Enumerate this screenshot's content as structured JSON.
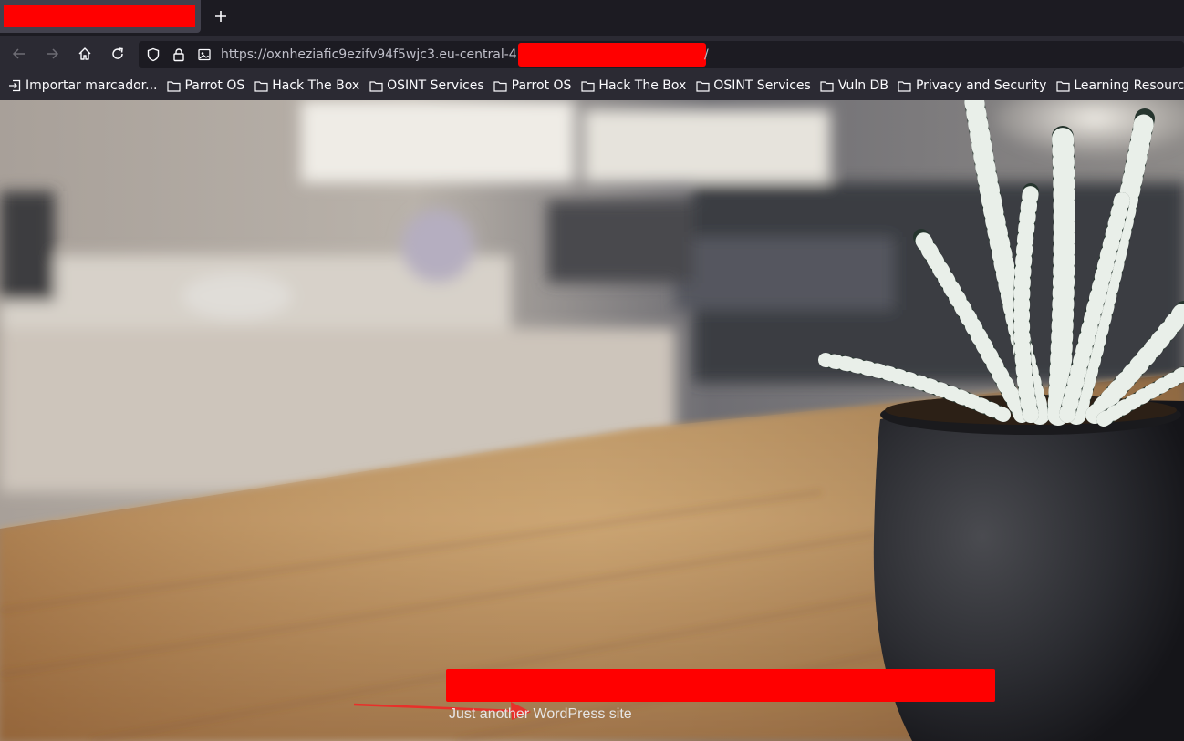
{
  "tabbar": {
    "active_tab_title": "",
    "new_tab_icon": "plus-icon"
  },
  "navbar": {
    "back_icon": "arrow-left-icon",
    "forward_icon": "arrow-right-icon",
    "home_icon": "home-icon",
    "reload_icon": "reload-icon",
    "url_prefix": "https://oxnheziafic9ezifv94f5wjc3.eu-central-4",
    "url_suffix": "/"
  },
  "bookmarks": {
    "items": [
      {
        "label": "Importar marcador...",
        "icon": "import-icon"
      },
      {
        "label": "Parrot OS",
        "icon": "folder-icon"
      },
      {
        "label": "Hack The Box",
        "icon": "folder-icon"
      },
      {
        "label": "OSINT Services",
        "icon": "folder-icon"
      },
      {
        "label": "Parrot OS",
        "icon": "folder-icon"
      },
      {
        "label": "Hack The Box",
        "icon": "folder-icon"
      },
      {
        "label": "OSINT Services",
        "icon": "folder-icon"
      },
      {
        "label": "Vuln DB",
        "icon": "folder-icon"
      },
      {
        "label": "Privacy and Security",
        "icon": "folder-icon"
      },
      {
        "label": "Learning Resources",
        "icon": "folder-icon"
      }
    ]
  },
  "page": {
    "tagline": "Just another WordPress site"
  },
  "colors": {
    "redaction": "#ff0000",
    "annotation_arrow": "#e8302a"
  }
}
